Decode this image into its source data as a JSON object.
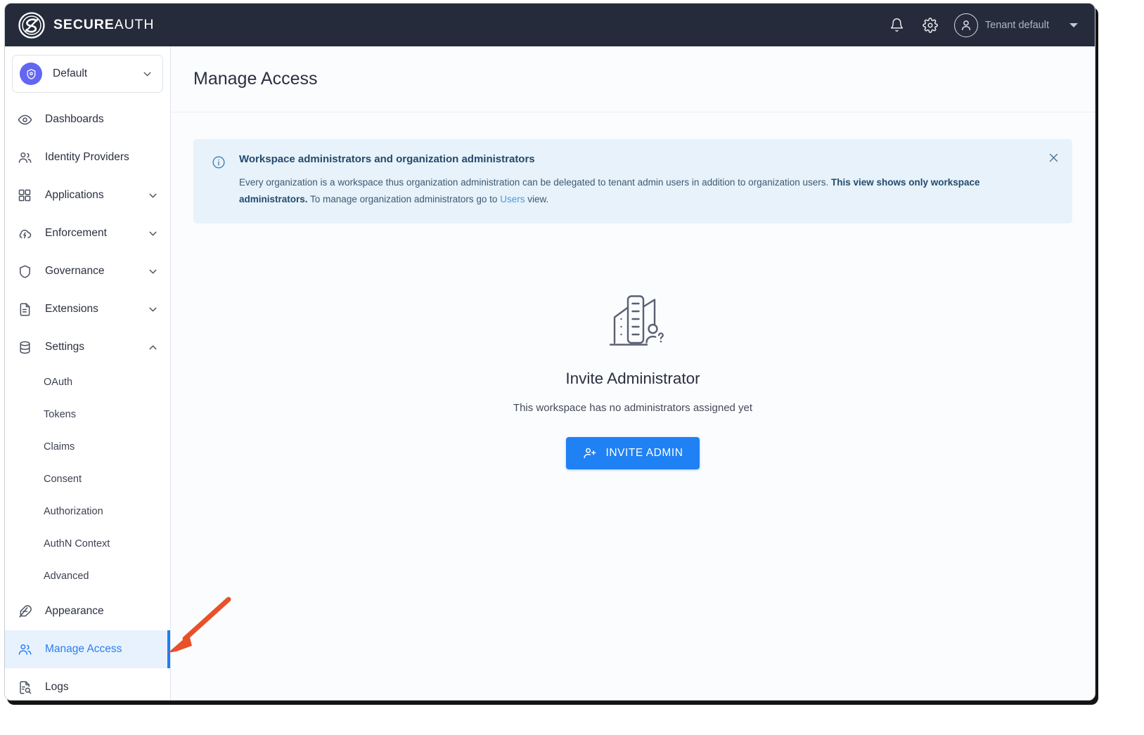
{
  "brand": {
    "bold": "SECURE",
    "light": "AUTH"
  },
  "topbar": {
    "notifications_icon": "bell-icon",
    "settings_icon": "gear-icon",
    "avatar_icon": "user-avatar-icon",
    "tenant_label": "Tenant default",
    "caret_icon": "caret-down-icon"
  },
  "sidebar": {
    "workspace": {
      "name": "Default",
      "icon": "shield-icon",
      "chevron": "chevron-down-icon"
    },
    "items": [
      {
        "label": "Dashboards",
        "icon": "eye-icon",
        "expandable": false,
        "active": false
      },
      {
        "label": "Identity Providers",
        "icon": "users-icon",
        "expandable": false,
        "active": false
      },
      {
        "label": "Applications",
        "icon": "grid-icon",
        "expandable": true,
        "active": false,
        "chevron": "chevron-down-icon"
      },
      {
        "label": "Enforcement",
        "icon": "cloud-bolt-icon",
        "expandable": true,
        "active": false,
        "chevron": "chevron-down-icon"
      },
      {
        "label": "Governance",
        "icon": "shield-outline-icon",
        "expandable": true,
        "active": false,
        "chevron": "chevron-down-icon"
      },
      {
        "label": "Extensions",
        "icon": "document-code-icon",
        "expandable": true,
        "active": false,
        "chevron": "chevron-down-icon"
      },
      {
        "label": "Settings",
        "icon": "database-icon",
        "expandable": true,
        "active": false,
        "expanded": true,
        "chevron": "chevron-up-icon"
      }
    ],
    "settings_children": [
      {
        "label": "OAuth"
      },
      {
        "label": "Tokens"
      },
      {
        "label": "Claims"
      },
      {
        "label": "Consent"
      },
      {
        "label": "Authorization"
      },
      {
        "label": "AuthN Context"
      },
      {
        "label": "Advanced"
      }
    ],
    "items_after": [
      {
        "label": "Appearance",
        "icon": "feather-icon",
        "active": false
      },
      {
        "label": "Manage Access",
        "icon": "users-icon",
        "active": true
      },
      {
        "label": "Logs",
        "icon": "log-search-icon",
        "active": false
      }
    ]
  },
  "main": {
    "page_title": "Manage Access",
    "banner": {
      "icon": "info-circle-icon",
      "close_icon": "close-icon",
      "title": "Workspace administrators and organization administrators",
      "text_part1": "Every organization is a workspace thus organization administration can be delegated to tenant admin users in addition to organization users. ",
      "text_bold": "This view shows only workspace administrators.",
      "text_part2": " To manage organization administrators go to ",
      "link": "Users",
      "text_part3": " view."
    },
    "empty_state": {
      "illustration": "office-buildings-person-question-icon",
      "title": "Invite Administrator",
      "subtitle": "This workspace has no administrators assigned yet",
      "button_label": "INVITE ADMIN",
      "button_icon": "user-plus-icon"
    }
  },
  "annotation": {
    "arrow": "orange-pointer-arrow",
    "color": "#e8512a"
  },
  "colors": {
    "topbar_bg": "#252b3a",
    "accent_blue": "#2081f4",
    "active_nav_bg": "#e8f2fe",
    "banner_bg": "#e7f2fa",
    "workspace_badge": "#6366f1"
  }
}
